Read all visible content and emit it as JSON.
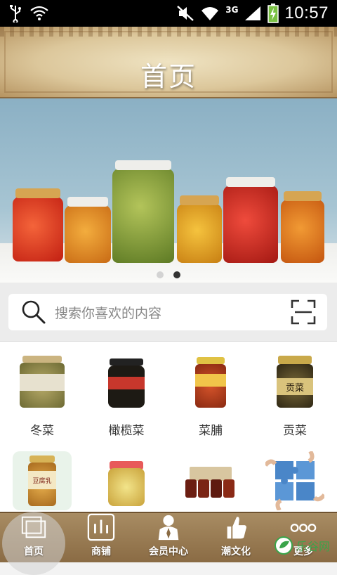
{
  "status_bar": {
    "time": "10:57",
    "network_type": "3G",
    "icons": [
      "usb-icon",
      "wifi-question-icon",
      "mute-icon",
      "wifi-icon",
      "signal-icon",
      "battery-charging-icon"
    ]
  },
  "header": {
    "title": "首页"
  },
  "banner": {
    "slide_count": 2,
    "active_slide": 2
  },
  "search": {
    "placeholder": "搜索你喜欢的内容"
  },
  "categories": [
    {
      "label": "冬菜"
    },
    {
      "label": "橄榄菜"
    },
    {
      "label": "菜脯"
    },
    {
      "label": "贡菜"
    },
    {
      "label": ""
    },
    {
      "label": ""
    },
    {
      "label": ""
    },
    {
      "label": ""
    }
  ],
  "category_images": {
    "item4_text": "贡菜",
    "item5_text": "豆腐乳"
  },
  "tabbar": {
    "tabs": [
      {
        "label": "首页",
        "icon": "home-pages-icon",
        "active": true
      },
      {
        "label": "商铺",
        "icon": "shop-bars-icon",
        "active": false
      },
      {
        "label": "会员中心",
        "icon": "member-icon",
        "active": false
      },
      {
        "label": "潮文化",
        "icon": "thumbs-up-icon",
        "active": false
      },
      {
        "label": "更多",
        "icon": "more-dots-icon",
        "active": false
      }
    ]
  },
  "watermark": {
    "text": "乐谷网"
  },
  "colors": {
    "header_gold": "#dcc79b",
    "tabbar_brown": "#8a6b44",
    "sky": "#a7c5d3"
  }
}
